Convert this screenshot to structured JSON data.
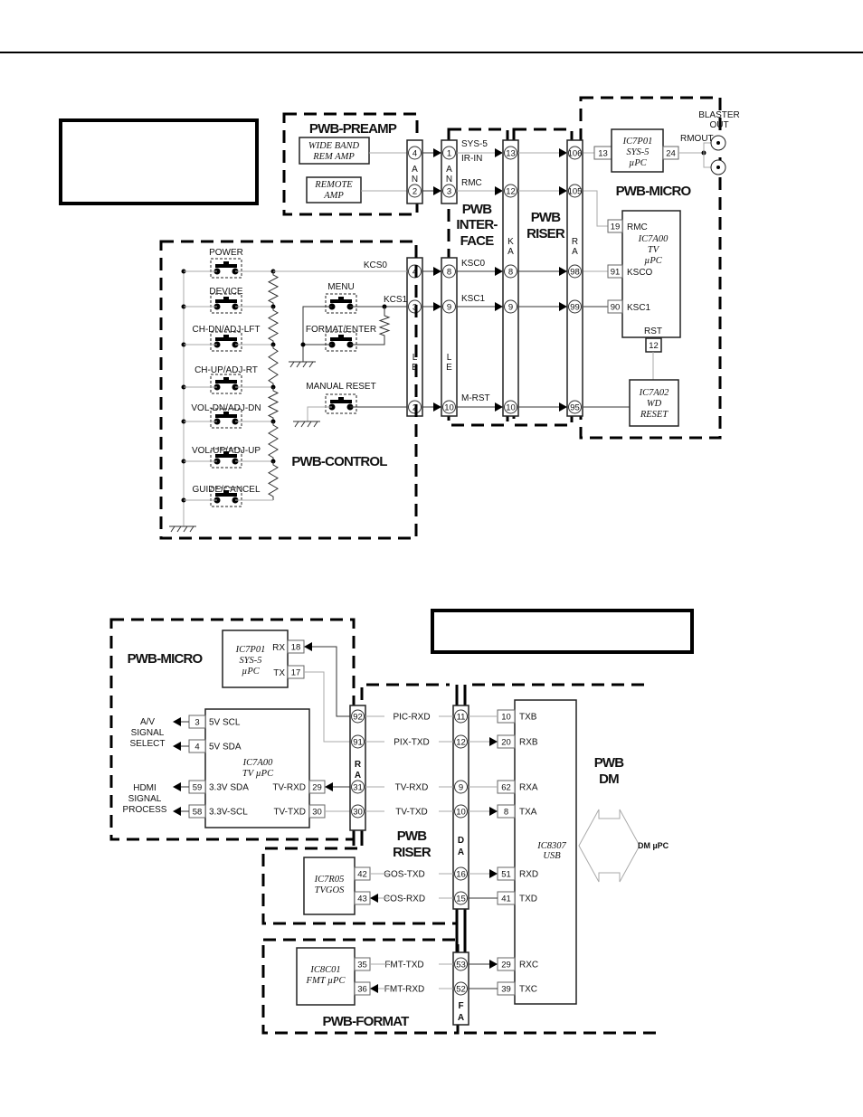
{
  "top": {
    "preamp": {
      "title": "PWB-PREAMP",
      "wide_band_amp": [
        "WIDE  BAND",
        "REM  AMP"
      ],
      "remote_amp": [
        "REMOTE",
        "AMP"
      ],
      "connector": {
        "letters": [
          "A",
          "N"
        ],
        "pins": [
          "4",
          "2"
        ]
      }
    },
    "interface": {
      "title": [
        "PWB",
        "INTER-",
        "FACE"
      ],
      "an_connector": {
        "letters": [
          "A",
          "N"
        ],
        "pins": [
          "1",
          "3"
        ]
      },
      "le_connector": {
        "letters": [
          "L",
          "E"
        ],
        "pins": [
          "8",
          "9",
          "10"
        ]
      },
      "signals": [
        "SYS-5",
        "IR-IN",
        "RMC",
        "KSC0",
        "KSC1",
        "M-RST"
      ]
    },
    "riser": {
      "title": [
        "PWB",
        "RISER"
      ],
      "ka_connector": {
        "letters": [
          "K",
          "A"
        ],
        "pins": [
          "13",
          "12",
          "8",
          "9",
          "10"
        ]
      }
    },
    "micro": {
      "title": "PWB-MICRO",
      "ra_connector": {
        "letters": [
          "R",
          "A"
        ],
        "pins": [
          "106",
          "105",
          "98",
          "99",
          "95"
        ]
      },
      "ic7p01": {
        "name": [
          "IC7P01",
          "SYS-5",
          "µPC"
        ],
        "pins": [
          "13",
          "24"
        ],
        "rmout": "RMOUT"
      },
      "blaster_out": [
        "BLASTER",
        "OUT"
      ],
      "ic7a00": {
        "name": [
          "IC7A00",
          "TV",
          "µPC"
        ],
        "pins": [
          "19",
          "91",
          "90",
          "12"
        ],
        "pin_labels": [
          "RMC",
          "KSCO",
          "KSC1",
          "RST"
        ]
      },
      "ic7a02": {
        "name": [
          "IC7A02",
          "WD",
          "RESET"
        ]
      }
    },
    "control": {
      "title": "PWB-CONTROL",
      "connector": {
        "letters": [
          "L",
          "E"
        ],
        "pins": [
          "4",
          "3",
          "2"
        ]
      },
      "nets": [
        "KCS0",
        "KCS1"
      ],
      "buttons": [
        "POWER",
        "DEVICE",
        "CH-DN/ADJ-LFT",
        "CH-UP/ADJ-RT",
        "VOL-DN/ADJ-DN",
        "VOL-UP/ADJ-UP",
        "GUIDE/CANCEL"
      ],
      "menu_button": "MENU",
      "format_button": "FORMAT/ENTER",
      "reset_button": "MANUAL  RESET"
    }
  },
  "bottom": {
    "micro": {
      "title": "PWB-MICRO",
      "ic7p01": {
        "name": [
          "IC7P01",
          "SYS-5",
          "µPC"
        ],
        "pins": [
          "18",
          "17"
        ],
        "pin_labels": [
          "RX",
          "TX"
        ]
      },
      "ic7a00": {
        "name": [
          "IC7A00",
          "TV  µPC"
        ],
        "left_pins": [
          "3",
          "4",
          "59",
          "58"
        ],
        "left_labels": [
          "5V  SCL",
          "5V  SDA",
          "3.3V  SDA",
          "3.3V-SCL"
        ],
        "right_pins": [
          "29",
          "30"
        ],
        "right_labels": [
          "TV-RXD",
          "TV-TXD"
        ]
      },
      "av_signal": [
        "A/V",
        "SIGNAL",
        "SELECT"
      ],
      "hdmi_signal": [
        "HDMI",
        "SIGNAL",
        "PROCESS"
      ],
      "ra_connector": {
        "letters": [
          "R",
          "A"
        ],
        "pins": [
          "92",
          "91",
          "31",
          "30"
        ]
      }
    },
    "riser": {
      "title": [
        "PWB",
        "RISER"
      ],
      "da_connector": {
        "letters": [
          "D",
          "A"
        ],
        "pins": [
          "11",
          "12",
          "9",
          "10",
          "16",
          "15"
        ]
      },
      "signals": [
        "PIC-RXD",
        "PIX-TXD",
        "TV-RXD",
        "TV-TXD",
        "GOS-TXD",
        "COS-RXD"
      ],
      "ic7r05": {
        "name": [
          "IC7R05",
          "TVGOS"
        ],
        "pins": [
          "42",
          "43"
        ]
      }
    },
    "format": {
      "title": "PWB-FORMAT",
      "fa_connector": {
        "letters": [
          "F",
          "A"
        ],
        "pins": [
          "53",
          "52"
        ]
      },
      "signals": [
        "FMT-TXD",
        "FMT-RXD"
      ],
      "ic8c01": {
        "name": [
          "IC8C01",
          "FMT  µPC"
        ],
        "pins": [
          "35",
          "36"
        ]
      }
    },
    "dm": {
      "title": [
        "PWB",
        "DM"
      ],
      "ic8307": {
        "name": [
          "IC8307",
          "USB"
        ],
        "pins": [
          "10",
          "20",
          "62",
          "8",
          "51",
          "41",
          "29",
          "39"
        ],
        "pin_labels": [
          "TXB",
          "RXB",
          "RXA",
          "TXA",
          "RXD",
          "TXD",
          "RXC",
          "TXC"
        ]
      },
      "bus_label": "DM µPC"
    }
  }
}
